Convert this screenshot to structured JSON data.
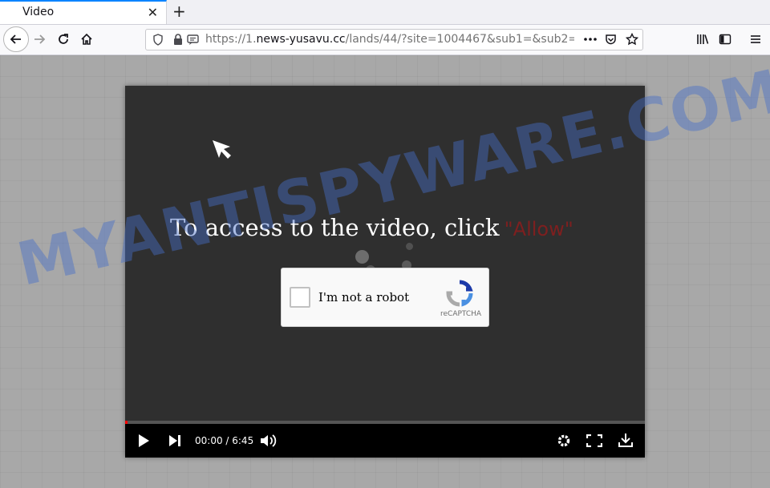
{
  "tab": {
    "title": "Video",
    "close": "✕"
  },
  "toolbar": {
    "new_tab": "+"
  },
  "url": {
    "prefix": "https://1.",
    "host": "news-yusavu.cc",
    "path": "/lands/44/?site=1004467&sub1=&sub2=&"
  },
  "page": {
    "headline": "To access to the video, click",
    "allow": "\"Allow\""
  },
  "captcha": {
    "label": "I'm not a robot",
    "brand": "reCAPTCHA"
  },
  "player": {
    "time": "00:00 / 6:45",
    "progress": 0.0
  },
  "watermark": {
    "text": "MYANTISPYWARE.COM"
  },
  "colors": {
    "accent": "#0a84ff",
    "player_bg": "#2f2f2f",
    "allow": "#7e1f1f"
  }
}
